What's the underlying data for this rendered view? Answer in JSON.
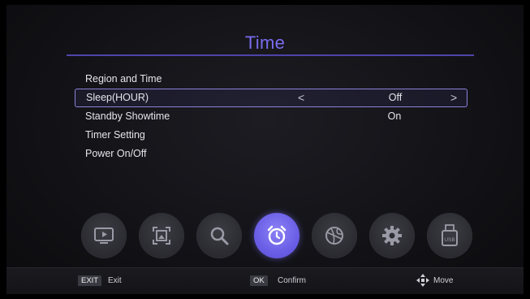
{
  "header": {
    "title": "Time"
  },
  "menu": {
    "items": [
      {
        "label": "Region and Time"
      },
      {
        "label": "Sleep(HOUR)",
        "value": "Off",
        "left_arrow": "<",
        "right_arrow": ">"
      },
      {
        "label": "Standby Showtime",
        "value": "On"
      },
      {
        "label": "Timer Setting"
      },
      {
        "label": "Power On/Off"
      }
    ]
  },
  "icons": [
    {
      "name": "tv-icon"
    },
    {
      "name": "picture-icon"
    },
    {
      "name": "search-icon"
    },
    {
      "name": "alarm-clock-icon",
      "active": true
    },
    {
      "name": "ball-icon"
    },
    {
      "name": "gear-icon"
    },
    {
      "name": "usb-icon",
      "text": "USB"
    }
  ],
  "footer": {
    "exit_key": "EXIT",
    "exit_label": "Exit",
    "ok_key": "OK",
    "ok_label": "Confirm",
    "move_label": "Move"
  },
  "colors": {
    "accent": "#7b6cf0",
    "rule": "#4f43a8",
    "active_icon": "#6a5ee6"
  }
}
